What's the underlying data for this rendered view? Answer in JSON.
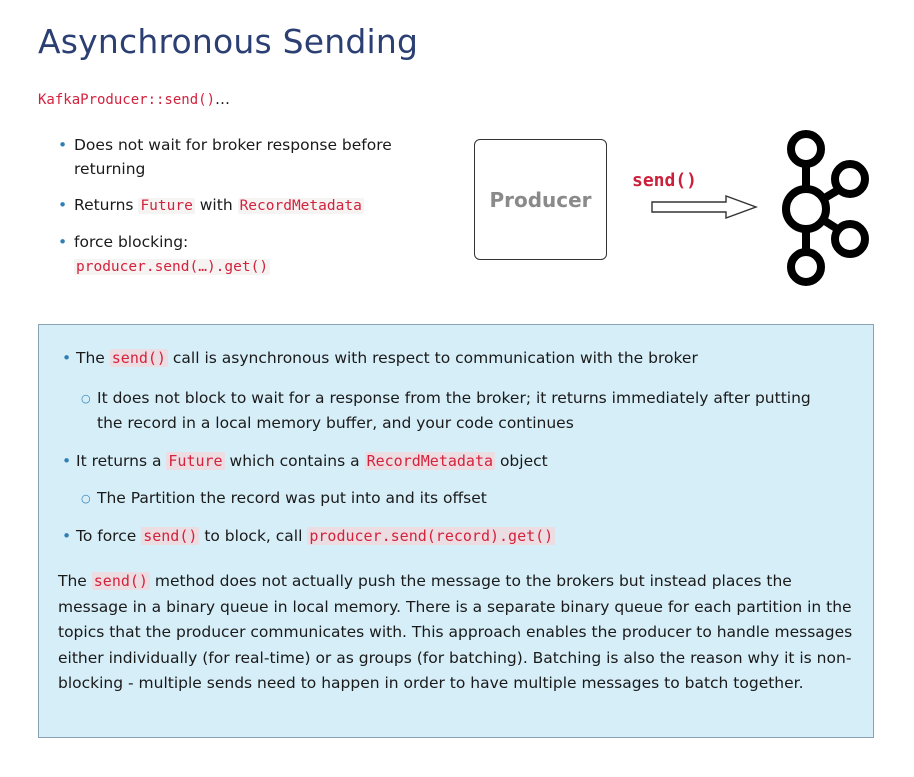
{
  "title": "Asynchronous Sending",
  "subtitle": {
    "code": "KafkaProducer::send()",
    "suffix": "…"
  },
  "top_bullets": {
    "b1": "Does not wait for broker response before returning",
    "b2_pre": "Returns ",
    "b2_code1": "Future",
    "b2_mid": " with ",
    "b2_code2": "RecordMetadata",
    "b3_text": "force blocking:",
    "b3_code": "producer.send(…).get()"
  },
  "diagram": {
    "producer_label": "Producer",
    "send_label": "send()",
    "logo_icon": "kafka-logo-icon",
    "arrow_icon": "hollow-arrow-right"
  },
  "notes": {
    "n1_pre": "The ",
    "n1_code": "send()",
    "n1_post": " call is asynchronous with respect to communication with the broker",
    "n1_sub": "It does not block to wait for a response from the broker; it returns immediately after putting the record in a local memory buffer, and your code continues",
    "n2_pre": "It returns a ",
    "n2_code1": "Future",
    "n2_mid": " which contains a ",
    "n2_code2": "RecordMetadata",
    "n2_post": " object",
    "n2_sub": "The Partition the record was put into and its offset",
    "n3_pre": "To force ",
    "n3_code1": "send()",
    "n3_mid": " to block, call ",
    "n3_code2": "producer.send(record).get()",
    "para_pre": "The ",
    "para_code": "send()",
    "para_post": " method does not actually push the message to the brokers but instead places the message in a binary queue in local memory. There is a separate binary queue for each partition in the topics that the producer communicates with. This approach enables the producer to handle messages either individually (for real-time) or as groups (for batching). Batching is also the reason why it is non-blocking - multiple sends need to happen in order to have multiple messages to batch together."
  },
  "colors": {
    "title": "#2b3f73",
    "code": "#d4223d",
    "notes_bg": "#d6eef8",
    "bullet": "#2f7fb5"
  }
}
